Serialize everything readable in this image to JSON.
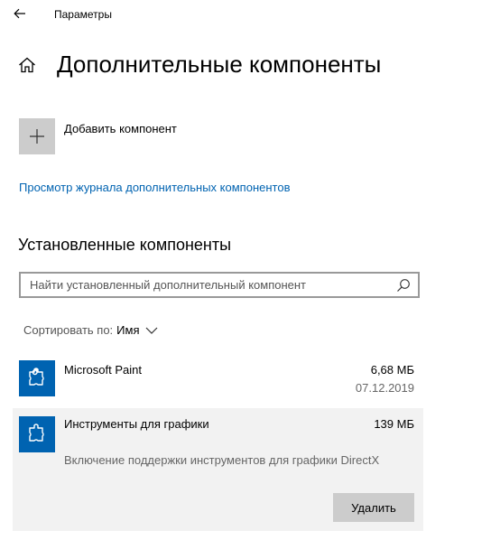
{
  "titlebar": {
    "back_icon": "arrow-left-icon",
    "title": "Параметры"
  },
  "header": {
    "home_icon": "home-icon",
    "title": "Дополнительные компоненты"
  },
  "add_component": {
    "icon": "plus-icon",
    "label": "Добавить компонент"
  },
  "history_link": "Просмотр журнала дополнительных компонентов",
  "installed": {
    "heading": "Установленные компоненты",
    "search": {
      "placeholder": "Найти установленный дополнительный компонент",
      "value": "",
      "icon": "search-icon"
    },
    "sort": {
      "label": "Сортировать по:",
      "value": "Имя"
    },
    "items": [
      {
        "icon": "puzzle-icon",
        "name": "Microsoft Paint",
        "size": "6,68 МБ",
        "date": "07.12.2019"
      },
      {
        "icon": "puzzle-icon",
        "name": "Инструменты для графики",
        "size": "139 МБ",
        "description": "Включение поддержки инструментов для графики DirectX",
        "remove_label": "Удалить",
        "selected": true
      }
    ]
  },
  "colors": {
    "accent": "#0063b1",
    "tile_gray": "#cccccc",
    "selected_bg": "#f2f2f2"
  }
}
